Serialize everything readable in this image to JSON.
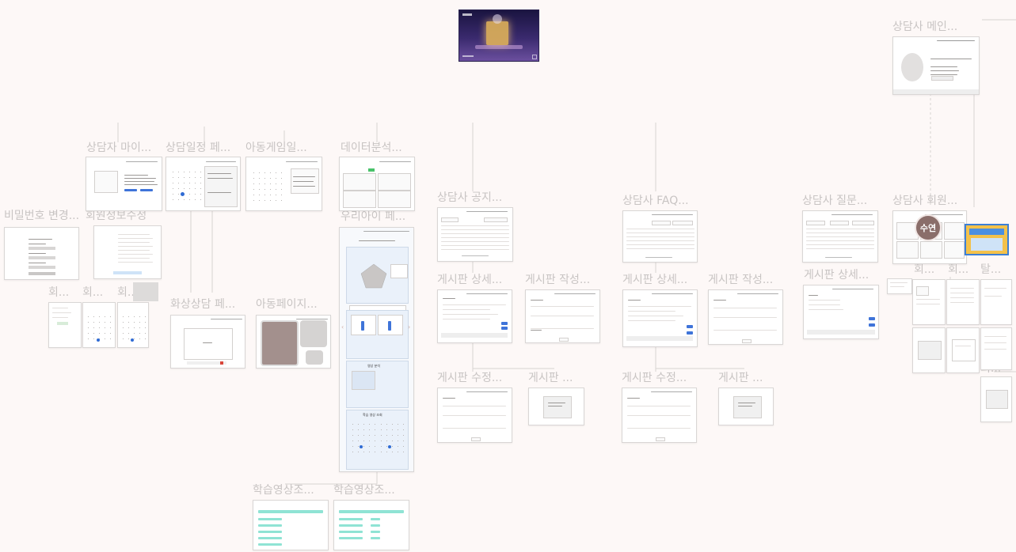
{
  "frames": {
    "counselor_main": "상담사 메인...",
    "counselor_my": "상담자 마이...",
    "schedule": "상담일정 페...",
    "kid_game": "아동게임일...",
    "data_analysis": "데이터분석...",
    "counselor_notice": "상담사 공지...",
    "counselor_faq": "상담사 FAQ...",
    "counselor_question": "상담사 질문...",
    "counselor_member": "상담사 회원...",
    "password_change": "비밀번호 변경...",
    "member_info_edit": "회원정보수정",
    "our_kid": "우리아이 페...",
    "video_counsel": "화상상담 페...",
    "kid_page": "아동페이지...",
    "board_detail_1": "게시판 상세...",
    "board_write_1": "게시판 작성...",
    "board_detail_2": "게시판 상세...",
    "board_write_2": "게시판 작성...",
    "board_detail_3": "게시판 상세...",
    "board_edit_1": "게시판 수정...",
    "board_popup_1": "게시판 ...",
    "board_edit_2": "게시판 수정...",
    "board_popup_2": "게시판 ...",
    "study_video_1": "학습영상조...",
    "study_video_2": "학습영상조...",
    "small_hoe": "회...",
    "small_tal": "탈..."
  },
  "avatar_text": "수연",
  "our_kid_headings": [
    "영상 분석",
    "학습 영상 조회"
  ],
  "colors": {
    "accent": "#3f74d9",
    "teal": "#8fe3d4",
    "avatar": "#8a6e6a",
    "label": "#c8c4c3"
  }
}
